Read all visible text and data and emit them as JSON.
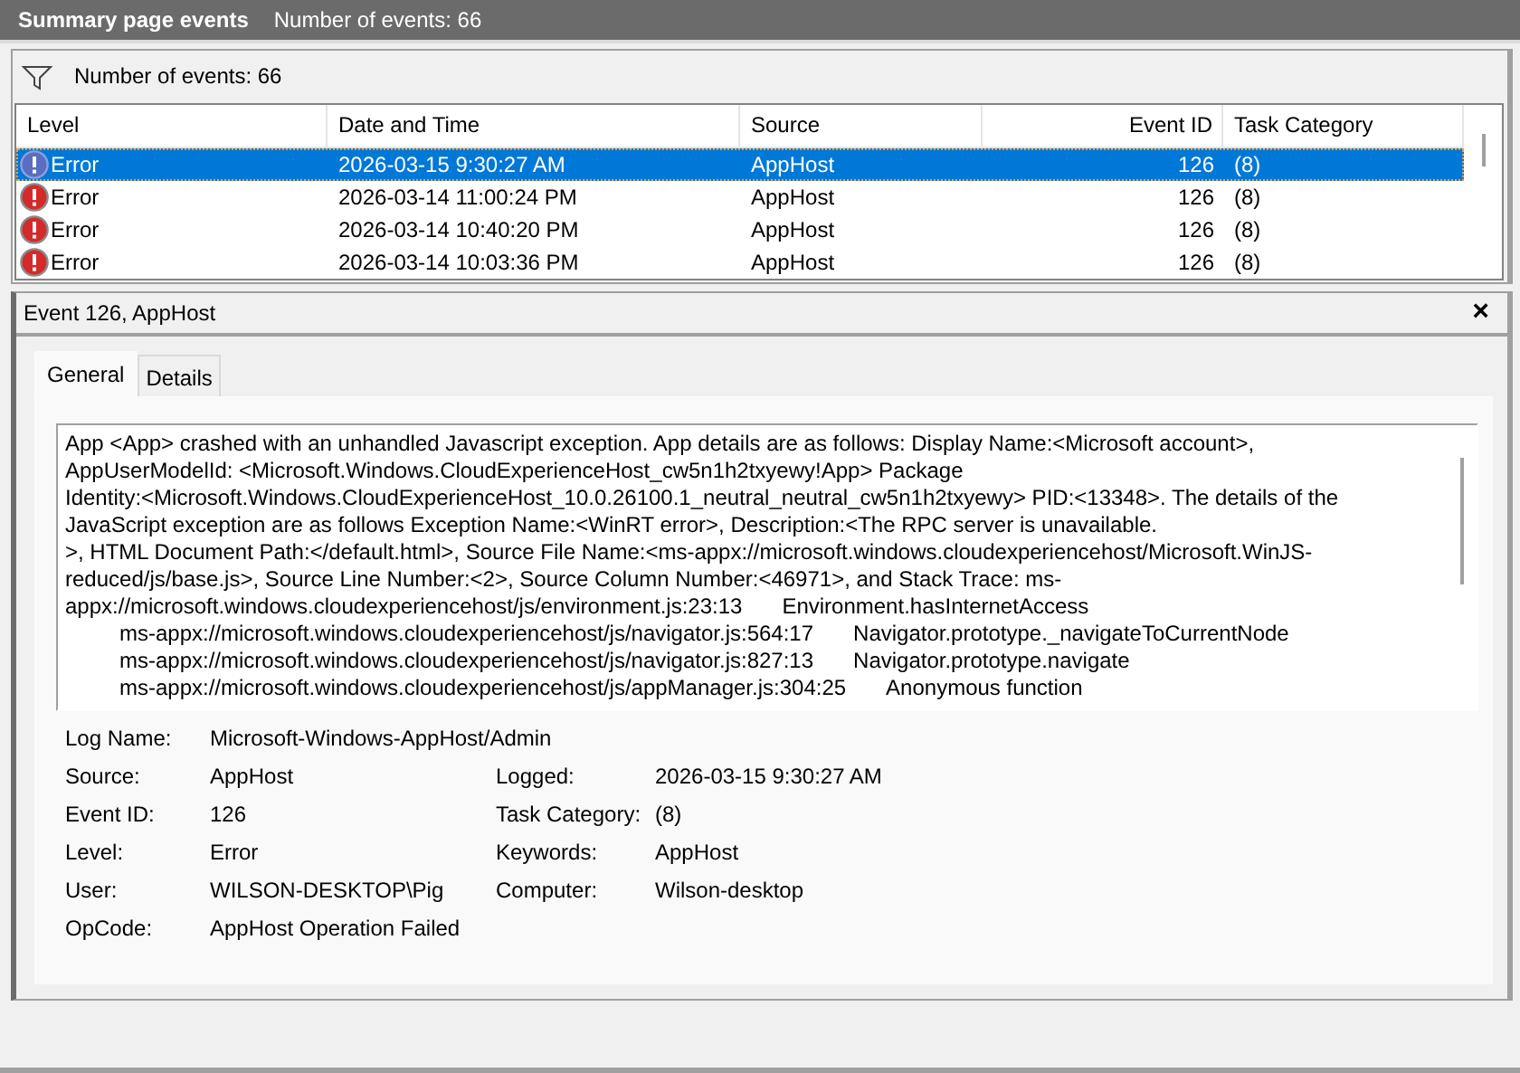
{
  "header": {
    "title": "Summary page events",
    "count": "Number of events: 66"
  },
  "filter": {
    "label": "Number of events: 66"
  },
  "table": {
    "columns": [
      "Level",
      "Date and Time",
      "Source",
      "Event ID",
      "Task Category"
    ],
    "rows": [
      {
        "selected": true,
        "cells": [
          "Error",
          "2026-03-15 9:30:27 AM",
          "AppHost",
          "126",
          "(8)"
        ]
      },
      {
        "selected": false,
        "cells": [
          "Error",
          "2026-03-14 11:00:24 PM",
          "AppHost",
          "126",
          "(8)"
        ]
      },
      {
        "selected": false,
        "cells": [
          "Error",
          "2026-03-14 10:40:20 PM",
          "AppHost",
          "126",
          "(8)"
        ]
      },
      {
        "selected": false,
        "cells": [
          "Error",
          "2026-03-14 10:03:36 PM",
          "AppHost",
          "126",
          "(8)"
        ]
      }
    ]
  },
  "detail": {
    "title": "Event 126, AppHost",
    "close": "×",
    "tabs": [
      {
        "label": "General",
        "selected": true
      },
      {
        "label": "Details",
        "selected": false
      }
    ],
    "description": [
      {
        "kind": "text",
        "text": "App <App> crashed with an unhandled Javascript exception. App details are as follows: Display Name:<Microsoft account>,"
      },
      {
        "kind": "text",
        "text": "AppUserModelId: <Microsoft.Windows.CloudExperienceHost_cw5n1h2txyewy!App> Package"
      },
      {
        "kind": "text",
        "text": "Identity:<Microsoft.Windows.CloudExperienceHost_10.0.26100.1_neutral_neutral_cw5n1h2txyewy> PID:<13348>. The details of the"
      },
      {
        "kind": "text",
        "text": "JavaScript exception are as follows Exception Name:<WinRT error>, Description:<The RPC server is unavailable."
      },
      {
        "kind": "text",
        "text": ">, HTML Document Path:</default.html>, Source File Name:<ms-appx://microsoft.windows.cloudexperiencehost/Microsoft.WinJS-"
      },
      {
        "kind": "text",
        "text": "reduced/js/base.js>, Source Line Number:<2>, Source Column Number:<46971>, and Stack Trace: ms-"
      },
      {
        "kind": "frame",
        "indent": false,
        "location": "appx://microsoft.windows.cloudexperiencehost/js/environment.js:23:13",
        "function": "Environment.hasInternetAccess"
      },
      {
        "kind": "frame",
        "indent": true,
        "location": "ms-appx://microsoft.windows.cloudexperiencehost/js/navigator.js:564:17",
        "function": "Navigator.prototype._navigateToCurrentNode"
      },
      {
        "kind": "frame",
        "indent": true,
        "location": "ms-appx://microsoft.windows.cloudexperiencehost/js/navigator.js:827:13",
        "function": "Navigator.prototype.navigate"
      },
      {
        "kind": "frame",
        "indent": true,
        "location": "ms-appx://microsoft.windows.cloudexperiencehost/js/appManager.js:304:25",
        "function": "Anonymous function"
      }
    ],
    "fields": [
      [
        {
          "label": "Log Name:",
          "value": "Microsoft-Windows-AppHost/Admin"
        }
      ],
      [
        {
          "label": "Source:",
          "value": "AppHost"
        },
        {
          "label": "Logged:",
          "value": "2026-03-15 9:30:27 AM"
        }
      ],
      [
        {
          "label": "Event ID:",
          "value": "126"
        },
        {
          "label": "Task Category:",
          "value": "(8)"
        }
      ],
      [
        {
          "label": "Level:",
          "value": "Error"
        },
        {
          "label": "Keywords:",
          "value": "AppHost"
        }
      ],
      [
        {
          "label": "User:",
          "value": "WILSON-DESKTOP\\Pig"
        },
        {
          "label": "Computer:",
          "value": "Wilson-desktop"
        }
      ],
      [
        {
          "label": "OpCode:",
          "value": "AppHost Operation Failed"
        }
      ]
    ]
  }
}
